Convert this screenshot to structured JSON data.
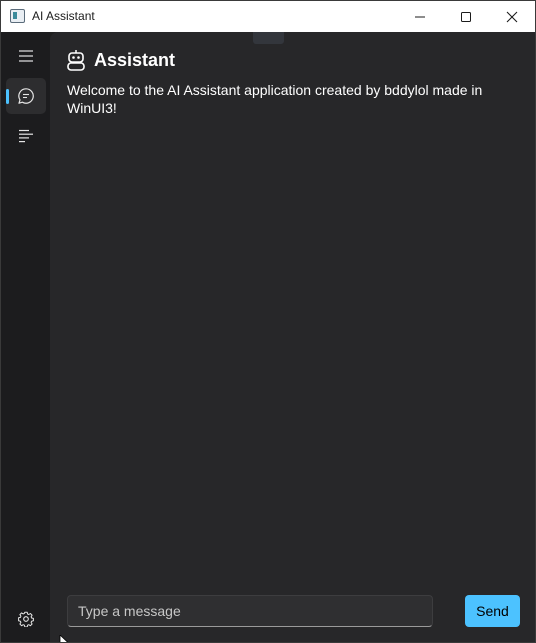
{
  "window": {
    "title": "AI Assistant",
    "accent_color": "#4cc2ff",
    "background_color": "#202020",
    "content_color": "#272729"
  },
  "nav": {
    "items": [
      {
        "icon": "hamburger-menu-icon",
        "selected": false
      },
      {
        "icon": "chat-bubble-icon",
        "selected": true
      },
      {
        "icon": "list-icon",
        "selected": false
      }
    ],
    "footer_icon": "settings-gear-icon"
  },
  "page": {
    "title_icon": "robot-icon",
    "title": "Assistant",
    "welcome_message": "Welcome to the AI Assistant application created by bddylol made in WinUI3!"
  },
  "composer": {
    "placeholder": "Type a message",
    "value": "",
    "send_label": "Send"
  }
}
